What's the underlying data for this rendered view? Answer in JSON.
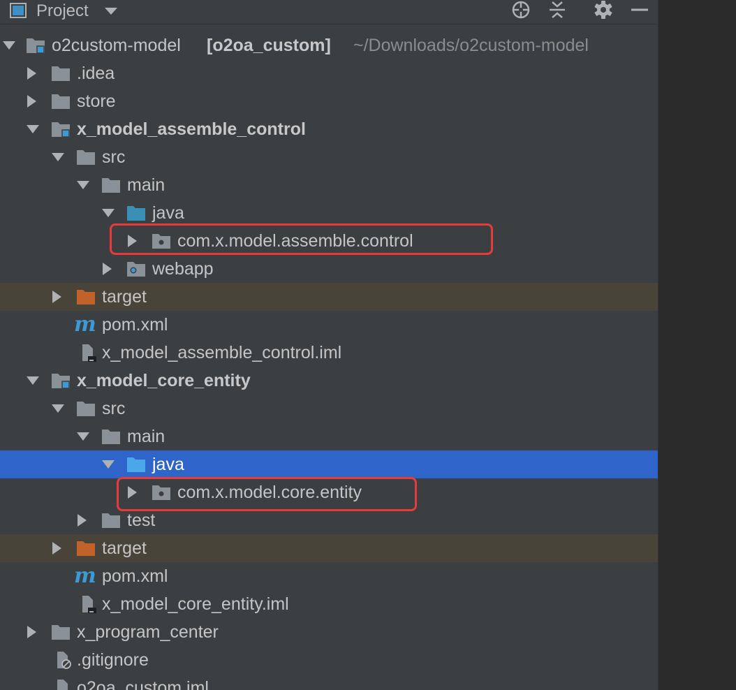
{
  "header": {
    "title": "Project",
    "icons": [
      "view-mode-icon",
      "dropdown-icon",
      "locate-icon",
      "collapse-all-icon",
      "gear-icon",
      "hide-icon"
    ]
  },
  "colors": {
    "panel_bg": "#3c3f41",
    "editor_bg": "#2b2b2b",
    "selection": "#2f65ca",
    "excluded_row": "#48443a",
    "folder": "#8a9199",
    "source_folder": "#3a8fb7",
    "excluded_folder": "#c0622a",
    "annotation": "#e63b3b"
  },
  "tree": {
    "root": {
      "name": "o2custom-model",
      "module": "[o2oa_custom]",
      "path": "~/Downloads/o2custom-model"
    },
    "idea": ".idea",
    "store": "store",
    "assemble": {
      "name": "x_model_assemble_control",
      "src": "src",
      "main": "main",
      "java": "java",
      "package": "com.x.model.assemble.control",
      "webapp": "webapp",
      "target": "target",
      "pom": "pom.xml",
      "iml": "x_model_assemble_control.iml"
    },
    "core": {
      "name": "x_model_core_entity",
      "src": "src",
      "main": "main",
      "java": "java",
      "package": "com.x.model.core.entity",
      "test": "test",
      "target": "target",
      "pom": "pom.xml",
      "iml": "x_model_core_entity.iml"
    },
    "program_center": "x_program_center",
    "gitignore": ".gitignore",
    "root_iml": "o2oa_custom.iml"
  }
}
